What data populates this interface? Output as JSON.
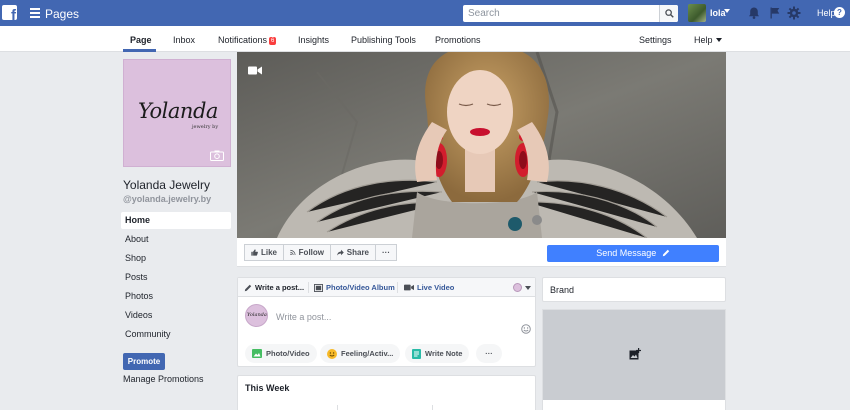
{
  "topbar": {
    "logo": "f",
    "section": "Pages",
    "search": {
      "placeholder": "Search",
      "value": ""
    },
    "user_name": "lola",
    "help": "Help"
  },
  "nav": {
    "tabs": [
      {
        "label": "Page"
      },
      {
        "label": "Inbox"
      },
      {
        "label": "Notifications",
        "badge": "6"
      },
      {
        "label": "Insights"
      },
      {
        "label": "Publishing Tools"
      },
      {
        "label": "Promotions"
      },
      {
        "label": "Settings"
      },
      {
        "label": "Help"
      }
    ]
  },
  "page": {
    "logo_text": "Yolanda",
    "logo_subtext": "jewelry by",
    "name": "Yolanda Jewelry",
    "handle": "@yolanda.jewelry.by"
  },
  "sidebar": {
    "items": [
      "Home",
      "About",
      "Shop",
      "Posts",
      "Photos",
      "Videos",
      "Community"
    ],
    "promote": "Promote",
    "manage": "Manage Promotions"
  },
  "actions": {
    "like": "Like",
    "follow": "Follow",
    "share": "Share",
    "more": "···",
    "send_message": "Send Message"
  },
  "composer": {
    "tabs": [
      "Write a post...",
      "Photo/Video Album",
      "Live Video"
    ],
    "avatar_text": "Yolanda",
    "placeholder": "Write a post...",
    "pills": [
      "Photo/Video",
      "Feeling/Activ...",
      "Write Note",
      "···"
    ]
  },
  "this_week": {
    "title": "This Week"
  },
  "right": {
    "brand": "Brand"
  },
  "colors": {
    "fb_blue": "#4267b2",
    "messenger_blue": "#4080ff",
    "badge_red": "#fa3e3e",
    "profile_pink": "#dcc0dd"
  },
  "icons": [
    "facebook-logo-icon",
    "hamburger-icon",
    "search-icon",
    "bell-icon",
    "flag-icon",
    "gear-icon",
    "help-icon",
    "camera-icon",
    "video-icon",
    "thumbs-up-icon",
    "rss-icon",
    "share-arrow-icon",
    "pencil-icon",
    "album-icon",
    "live-video-icon",
    "smile-icon",
    "photo-icon",
    "feeling-icon",
    "note-icon",
    "add-photo-icon"
  ]
}
